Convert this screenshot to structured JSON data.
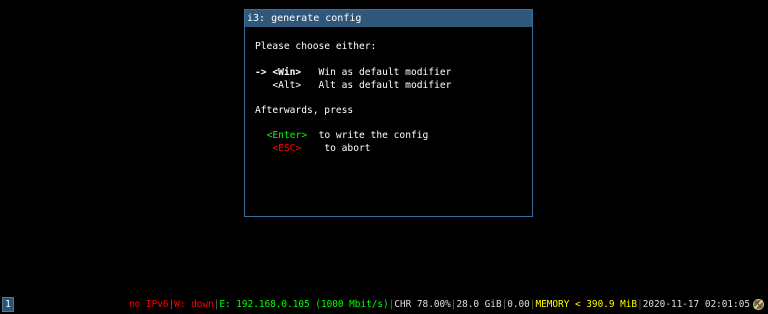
{
  "dialog": {
    "title": "i3: generate config",
    "line_choose": "Please choose either:",
    "option_win_arrow": "-> ",
    "option_win_key": "<Win>",
    "option_win_desc": "Win as default modifier",
    "option_alt_key": "<Alt>",
    "option_alt_desc": "Alt as default modifier",
    "line_afterwards": "Afterwards, press",
    "enter_key": "<Enter>",
    "enter_desc": "to write the config",
    "esc_key": "<ESC>",
    "esc_desc": "to abort"
  },
  "bar": {
    "workspace": "1",
    "ipv6": "no IPv6",
    "wireless": "W: down",
    "ethernet": "E: 192.168.0.105 (1000 Mbit/s)",
    "cpu": "CHR 78.00%",
    "disk": "28.0 GiB",
    "load": "0.00",
    "memory": "MEMORY < 390.9 MiB",
    "datetime": "2020-11-17 02:01:05",
    "separator": "|",
    "tray_icon": "network-manager-icon"
  },
  "colors": {
    "title_bg": "#30587a",
    "border": "#3d6f9c",
    "key_green": "#00ff00",
    "key_red": "#ff0000",
    "memory_yellow": "#ffff00",
    "workspace_bg": "#285577"
  }
}
